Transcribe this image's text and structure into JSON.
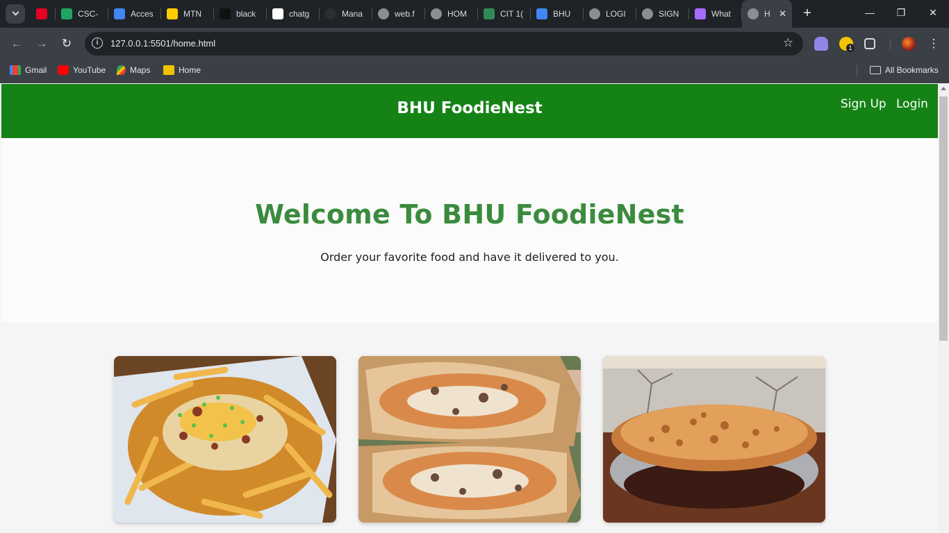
{
  "browser": {
    "tabs": [
      {
        "title": "",
        "icon": "pinterest-icon",
        "color": "#e60023"
      },
      {
        "title": "CSC-",
        "icon": "sheets-icon",
        "color": "#1fa463"
      },
      {
        "title": "Acces",
        "icon": "docs-icon",
        "color": "#4285f4"
      },
      {
        "title": "MTN",
        "icon": "mtn-icon",
        "color": "#ffcc00"
      },
      {
        "title": "black",
        "icon": "black-icon",
        "color": "#111111"
      },
      {
        "title": "chatg",
        "icon": "chatgpt-icon",
        "color": "#ffffff"
      },
      {
        "title": "Mana",
        "icon": "github-icon",
        "color": "#2b2f33"
      },
      {
        "title": "web.f",
        "icon": "facebook-icon",
        "color": "#8a8f94"
      },
      {
        "title": "HOM",
        "icon": "globe-icon",
        "color": "#8a8f94"
      },
      {
        "title": "CIT 1(",
        "icon": "school-icon",
        "color": "#2e8b57"
      },
      {
        "title": "BHU",
        "icon": "docs-icon",
        "color": "#4285f4"
      },
      {
        "title": "LOGI",
        "icon": "globe-icon",
        "color": "#8a8f94"
      },
      {
        "title": "SIGN",
        "icon": "globe-icon",
        "color": "#8a8f94"
      },
      {
        "title": "What",
        "icon": "cube-icon",
        "color": "#a56bff"
      },
      {
        "title": "H",
        "icon": "globe-icon",
        "color": "#8a8f94"
      }
    ],
    "url": "127.0.0.1:5501/home.html",
    "bookmarks": [
      {
        "label": "Gmail",
        "icon": "gmail-icon"
      },
      {
        "label": "YouTube",
        "icon": "youtube-icon"
      },
      {
        "label": "Maps",
        "icon": "maps-icon"
      },
      {
        "label": "Home",
        "icon": "home-icon"
      }
    ],
    "all_bookmarks": "All Bookmarks",
    "extension_badge": "1"
  },
  "site": {
    "brand": "BHU FoodieNest",
    "nav": {
      "signup": "Sign Up",
      "login": "Login"
    },
    "hero": {
      "title": "Welcome To BHU FoodieNest",
      "subtitle": "Order your favorite food and have it delivered to you."
    },
    "cards": [
      {
        "image": "loaded-fries-image"
      },
      {
        "image": "burrito-image"
      },
      {
        "image": "pie-image"
      }
    ],
    "colors": {
      "header": "#158216",
      "title": "#3b8b3e"
    }
  }
}
